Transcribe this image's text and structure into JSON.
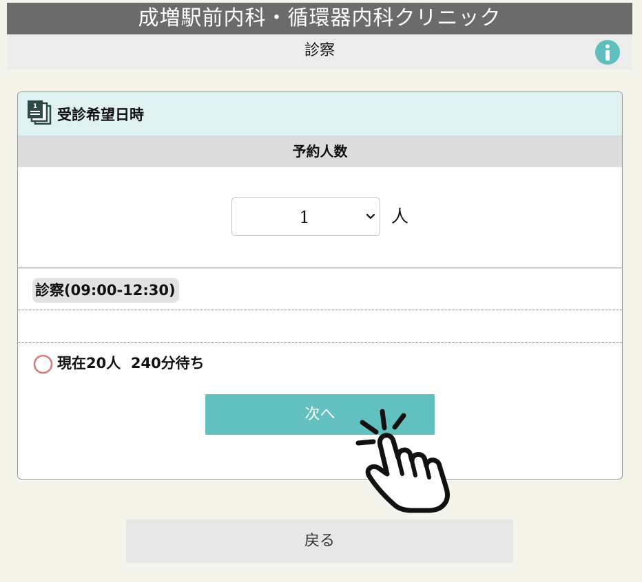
{
  "header": {
    "clinic_name": "成増駅前内科・循環器内科クリニック",
    "page_title": "診察",
    "info_icon": "info-icon"
  },
  "card": {
    "title": "受診希望日時",
    "icon": "calendar-list-icon",
    "party_size_heading": "予約人数",
    "party_size_select": {
      "value": "1",
      "unit": "人"
    },
    "time_slot_label": "診察(09:00-12:30)",
    "status": {
      "icon": "available-circle-icon",
      "text": "現在20人  240分待ち"
    },
    "next_label": "次へ"
  },
  "back_label": "戻る",
  "colors": {
    "title_bar": "#6b6b6b",
    "accent_teal": "#62c1c0",
    "card_header": "#dff1f1",
    "status_circle": "#dc7a7a"
  }
}
